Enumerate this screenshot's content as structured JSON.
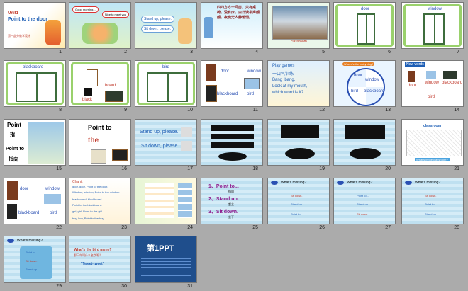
{
  "slides": [
    {
      "n": "1",
      "unit": "Unit1",
      "title": "Point to the door",
      "sub": "第一部分教学设计"
    },
    {
      "n": "2",
      "b1": "Good morning...",
      "b2": "Nice to meet you"
    },
    {
      "n": "3",
      "b1": "Stand up, please.",
      "b2": "Sit down, please."
    },
    {
      "n": "4",
      "poem": "四四方方一间房，只有桌椅，没有床，白日读书声朗朗，夜晚无人静悄悄。"
    },
    {
      "n": "5",
      "cap": "classroom"
    },
    {
      "n": "6",
      "cap": "door"
    },
    {
      "n": "7",
      "cap": "window"
    },
    {
      "n": "8",
      "cap": "blackboard"
    },
    {
      "n": "9",
      "w1": "board",
      "w2": "black"
    },
    {
      "n": "10",
      "cap": "bird"
    },
    {
      "n": "11",
      "w1": "door",
      "w2": "window",
      "w3": "blackboard",
      "w4": "bird"
    },
    {
      "n": "12",
      "t1": "Play games",
      "t2": "一口气训练",
      "t3": "Bang ,bang.",
      "t4": "Look at my mouth,",
      "t5": "which word is it?"
    },
    {
      "n": "13",
      "t1": "Where's the lucky dog?",
      "w1": "door",
      "w2": "window",
      "w3": "bird",
      "w4": "blackboard"
    },
    {
      "n": "14",
      "t1": "New words",
      "w1": "door",
      "w2": "window",
      "w3": "blackboard",
      "w4": "bird"
    },
    {
      "n": "15",
      "t1": "Point",
      "t2": "指",
      "t3": "Point to",
      "t4": "指向"
    },
    {
      "n": "16",
      "t1": "Point to",
      "t2": "the"
    },
    {
      "n": "17",
      "t1": "Stand up, please.",
      "t2": "Sit down, please."
    },
    {
      "n": "18"
    },
    {
      "n": "19"
    },
    {
      "n": "20"
    },
    {
      "n": "21",
      "t1": "classroom",
      "t2": "What's in the classroom?"
    },
    {
      "n": "22",
      "w1": "door",
      "w2": "window",
      "w3": "blackboard",
      "w4": "bird"
    },
    {
      "n": "23",
      "t1": "Chant:",
      "l1": "door, door, Point to the door.",
      "l2": "Window, window, Point to the window.",
      "l3": "blackboard, blackboard.",
      "l4": "Point to the blackboard.",
      "l5": "girl, girl, Point to the girl.",
      "l6": "boy, boy, Point to the boy."
    },
    {
      "n": "24"
    },
    {
      "n": "25",
      "l1": "1、Point to...",
      "s1": "指向",
      "l2": "2、Stand up.",
      "s2": "起立",
      "l3": "3、Sit down.",
      "s3": "坐下"
    },
    {
      "n": "26",
      "t1": "What's missing?",
      "a": "Sit down.",
      "b": "Stand up.",
      "c": "Point to..."
    },
    {
      "n": "27",
      "t1": "What's missing?",
      "a": "Point to...",
      "b": "Stand up.",
      "c": "Sit down."
    },
    {
      "n": "28",
      "t1": "What's missing?",
      "a": "Sit down.",
      "b": "Point to...",
      "c": "Stand up."
    },
    {
      "n": "29",
      "t1": "What's missing?",
      "a": "Point to...",
      "b": "Sit down.",
      "c": "Stand up."
    },
    {
      "n": "30",
      "t1": "What's the bird name?",
      "t2": "那只鸟叫什么名字呢？",
      "t3": "\"Tweet-tweet\""
    },
    {
      "n": "31",
      "logo": "第1PPT"
    }
  ]
}
